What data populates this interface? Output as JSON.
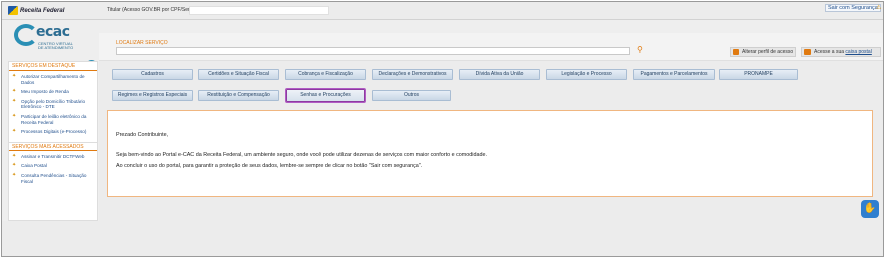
{
  "topbar": {
    "brand_label": "Receita Federal",
    "titular_label": "Titular (Acesso GOV.BR por CPF/Senha):",
    "titular_value": "",
    "logout_label": "Sair com Segurança"
  },
  "brand": {
    "name": "ecac",
    "subtitle_line1": "CENTRO VIRTUAL",
    "subtitle_line2": "DE ATENDIMENTO"
  },
  "search": {
    "label": "LOCALIZAR SERVIÇO",
    "value": "",
    "profile_button": "Alterar perfil de acesso",
    "mailbox_prefix": "Acesse a sua",
    "mailbox_link": "caixa postal"
  },
  "sidebar": {
    "featured_title": "SERVIÇOS EM DESTAQUE",
    "featured_items": [
      "Autorizar Compartilhamento de Dados",
      "Meu Imposto de Renda",
      "Opção pelo Domicílio Tributário Eletrônico - DTE",
      "Participar de leilão eletrônico da Receita Federal",
      "Processos Digitais (e-Processo)"
    ],
    "most_accessed_title": "SERVIÇOS MAIS ACESSADOS",
    "most_accessed_items": [
      "Assinar e Transmitir DCTFWeb",
      "Caixa Postal",
      "Consulta Pendências - Situação Fiscal"
    ]
  },
  "nav_row1": [
    "Cadastros",
    "Certidões e Situação Fiscal",
    "Cobrança e Fiscalização",
    "Declarações e Demonstrativos",
    "Dívida Ativa da União",
    "Legislação e Processo",
    "Pagamentos e Parcelamentos",
    "PRONAMPE"
  ],
  "nav_row2": [
    "Regimes e Registros Especiais",
    "Restituição e Compensação",
    "Senhas e Procurações",
    "Outros"
  ],
  "active_nav": "Senhas e Procurações",
  "welcome": {
    "greeting": "Prezado Contribuinte,",
    "line1": "Seja bem-vindo ao Portal e-CAC da Receita Federal, um ambiente seguro, onde você pode utilizar dezenas de serviços com maior conforto e comodidade.",
    "line2": "Ao concluir o uso do portal, para garantir a proteção de seus dados, lembre-se sempre de clicar no botão \"Sair com segurança\"."
  },
  "icons": {
    "search": "magnifier-icon",
    "home": "home-icon",
    "chat": "accessibility-hand-icon"
  },
  "colors": {
    "accent_orange": "#e07a10",
    "brand_blue": "#2a8fb5",
    "link_blue": "#1f4e8c",
    "active_outline": "#8e3aa0"
  }
}
